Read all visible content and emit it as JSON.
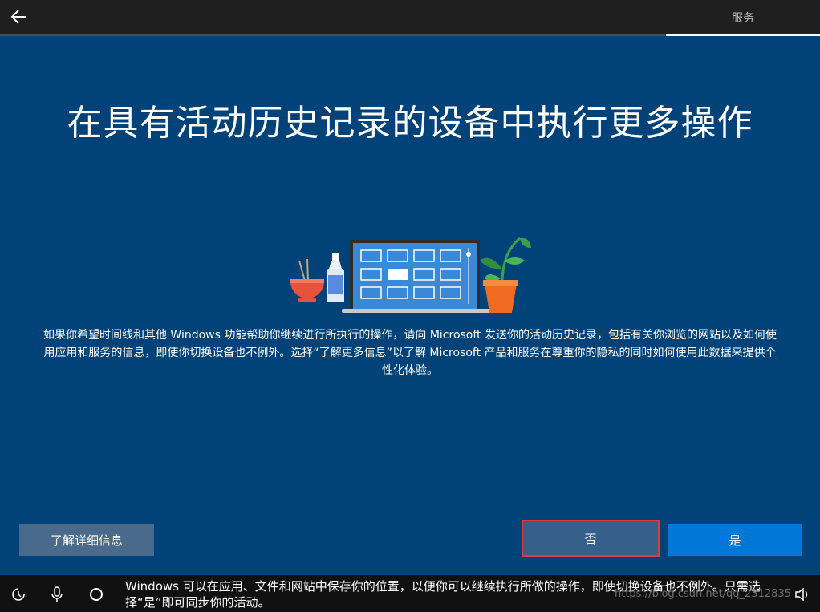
{
  "header": {
    "section_label": "服务"
  },
  "main": {
    "title": "在具有活动历史记录的设备中执行更多操作",
    "description": "如果你希望时间线和其他 Windows 功能帮助你继续进行所执行的操作，请向 Microsoft 发送你的活动历史记录，包括有关你浏览的网站以及如何使用应用和服务的信息，即使你切换设备也不例外。选择“了解更多信息”以了解 Microsoft 产品和服务在尊重你的隐私的同时如何使用此数据来提供个性化体验。",
    "buttons": {
      "learn_more": "了解详细信息",
      "no": "否",
      "yes": "是"
    }
  },
  "footer": {
    "narration": "Windows 可以在应用、文件和网站中保存你的位置，以便你可以继续执行所做的操作，即使切换设备也不例外。只需选择“是”即可同步你的活动。",
    "watermark": "https://blog.csdn.net/qq_2312835"
  },
  "colors": {
    "background": "#014379",
    "topbar": "#1f1f1f",
    "primary_button": "#0078d7",
    "secondary_button": "#4a6a8c",
    "highlight_border": "#e23a3a"
  },
  "icons": {
    "back": "back-arrow-icon",
    "ease_of_access": "ease-of-access-icon",
    "microphone": "microphone-icon",
    "cortana": "cortana-circle-icon",
    "volume": "volume-icon"
  }
}
